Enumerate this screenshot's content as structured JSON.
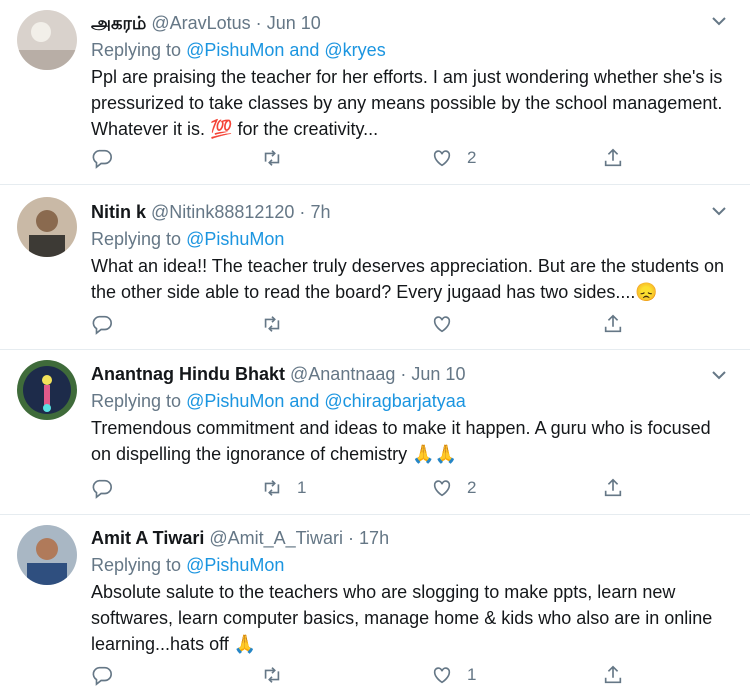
{
  "tweets": [
    {
      "name": "அகரம்",
      "handle": "@AravLotus",
      "dot": "·",
      "time": "Jun 10",
      "replying_prefix": "Replying to ",
      "replying_links": "@PishuMon and @kryes",
      "text_before": "Ppl are praising the teacher for her efforts. I am just wondering whether she's is pressurized to take classes by any means possible by the school management. Whatever it is.",
      "emoji": "💯",
      "text_after": " for the creativity...",
      "reply_count": "",
      "retweet_count": "",
      "like_count": "2"
    },
    {
      "name": "Nitin k",
      "handle": "@Nitink88812120",
      "dot": "·",
      "time": "7h",
      "replying_prefix": "Replying to ",
      "replying_links": "@PishuMon",
      "text_before": "What an idea!! The teacher truly deserves appreciation. But are the students on the other side able to read the board? Every jugaad has two sides....",
      "emoji": "😞",
      "text_after": "",
      "reply_count": "",
      "retweet_count": "",
      "like_count": ""
    },
    {
      "name": "Anantnag Hindu Bhakt",
      "handle": "@Anantnaag",
      "dot": "·",
      "time": "Jun 10",
      "replying_prefix": "Replying to ",
      "replying_links": "@PishuMon and @chiragbarjatyaa",
      "text_before": "Tremendous commitment and ideas to make it happen. A guru who is focused on dispelling the ignorance of chemistry ",
      "emoji": "🙏🙏",
      "text_after": "",
      "reply_count": "",
      "retweet_count": "1",
      "like_count": "2"
    },
    {
      "name": "Amit A Tiwari",
      "handle": "@Amit_A_Tiwari",
      "dot": "·",
      "time": "17h",
      "replying_prefix": "Replying to ",
      "replying_links": "@PishuMon",
      "text_before": "Absolute salute to the teachers who are slogging to make ppts, learn new softwares, learn computer basics, manage home & kids who also are in online learning...hats off ",
      "emoji": "🙏",
      "text_after": "",
      "reply_count": "",
      "retweet_count": "",
      "like_count": "1"
    }
  ],
  "colors": {
    "link": "#1b95e0",
    "muted": "#657786",
    "text": "#14171a",
    "divider": "#e6ecf0"
  },
  "icons": [
    "reply-icon",
    "retweet-icon",
    "like-icon",
    "share-icon",
    "chevron-down-icon"
  ]
}
